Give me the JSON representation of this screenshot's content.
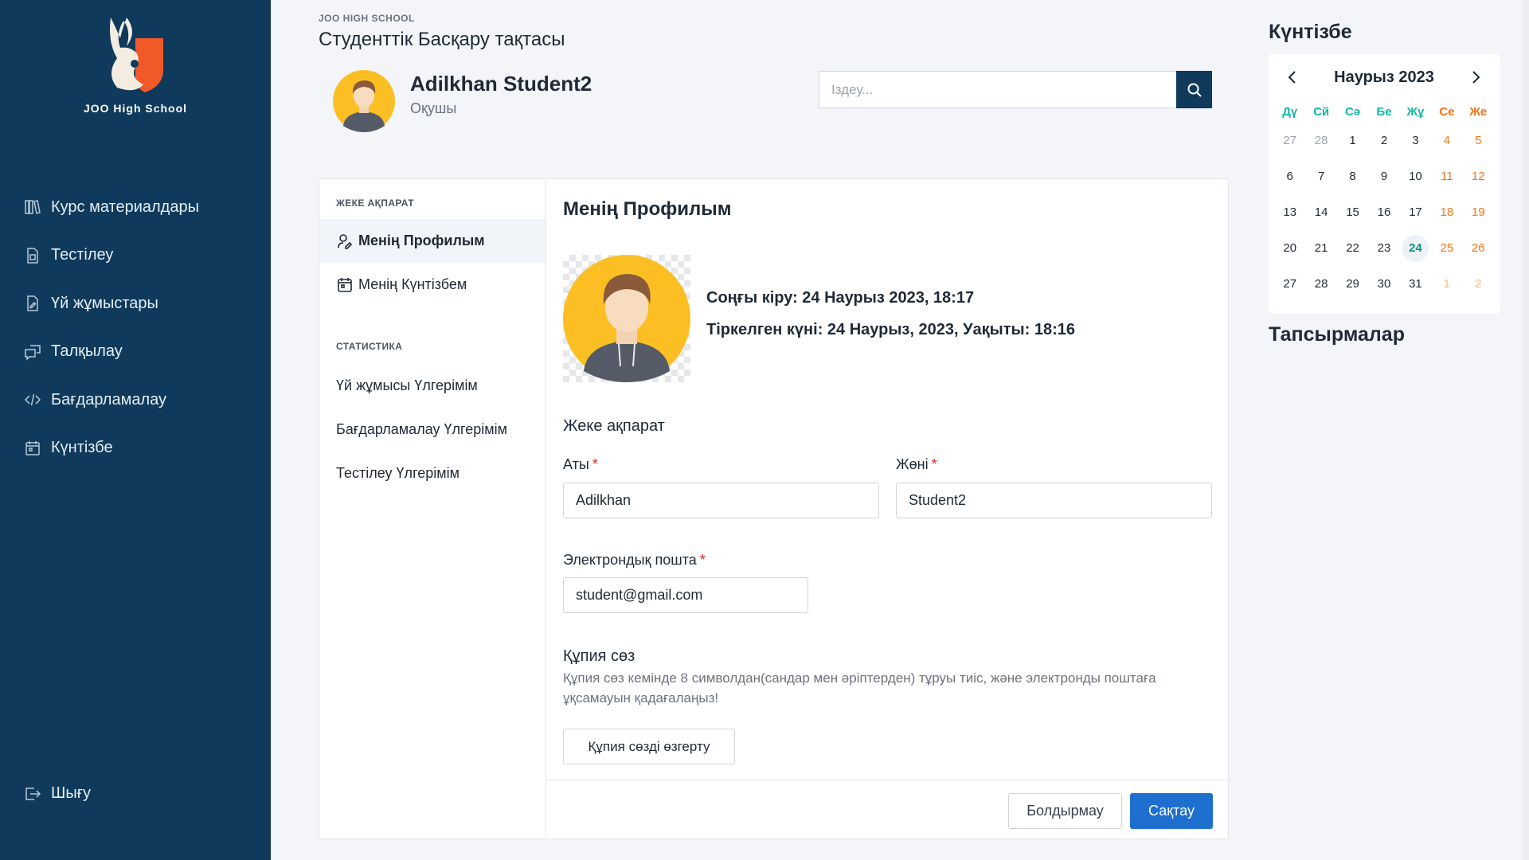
{
  "school": {
    "name": "JOO High School",
    "header_label": "JOO HIGH SCHOOL"
  },
  "dashboard_title": "Студенттік Басқару тақтасы",
  "user": {
    "name": "Adilkhan Student2",
    "role": "Оқушы"
  },
  "search": {
    "placeholder": "Іздеу..."
  },
  "sidebar": {
    "items": [
      {
        "label": "Курс материалдары",
        "icon": "books-icon"
      },
      {
        "label": "Тестілеу",
        "icon": "test-document-icon"
      },
      {
        "label": "Үй жұмыстары",
        "icon": "edit-document-icon"
      },
      {
        "label": "Талқылау",
        "icon": "chat-icon"
      },
      {
        "label": "Бағдарламалау",
        "icon": "code-icon"
      },
      {
        "label": "Күнтізбе",
        "icon": "calendar-icon"
      }
    ],
    "logout": "Шығу"
  },
  "subnav": {
    "personal_section": "ЖЕКЕ АҚПАРАТ",
    "profile": "Менің Профилым",
    "calendar": "Менің Күнтізбем",
    "stats_section": "СТАТИСТИКА",
    "homework_progress": "Үй жұмысы Үлгерімім",
    "programming_progress": "Бағдарламалау Үлгерімім",
    "testing_progress": "Тестілеу Үлгерімім"
  },
  "profile": {
    "title": "Менің Профилым",
    "last_login": "Соңғы кіру: 24 Наурыз 2023, 18:17",
    "registered": "Тіркелген күні: 24 Наурыз, 2023, Уақыты: 18:16",
    "personal_heading": "Жеке ақпарат",
    "first_name_label": "Аты",
    "first_name": "Adilkhan",
    "last_name_label": "Жөні",
    "last_name": "Student2",
    "email_label": "Электрондық пошта",
    "email": "student@gmail.com",
    "required_mark": "*",
    "password_heading": "Құпия сөз",
    "password_help": "Құпия сөз кемінде 8 символдан(сандар мен әріптерден) тұруы тиіс, және электронды поштаға ұқсамауын қадағалаңыз!",
    "change_password": "Құпия сөзді өзгерту",
    "cancel": "Болдырмау",
    "save": "Сақтау"
  },
  "calendar": {
    "heading": "Күнтізбе",
    "month": "Наурыз 2023",
    "weekdays": [
      "Дү",
      "Сй",
      "Сә",
      "Бе",
      "Жұ",
      "Се",
      "Же"
    ],
    "weeks": [
      [
        "27",
        "28",
        "1",
        "2",
        "3",
        "4",
        "5"
      ],
      [
        "6",
        "7",
        "8",
        "9",
        "10",
        "11",
        "12"
      ],
      [
        "13",
        "14",
        "15",
        "16",
        "17",
        "18",
        "19"
      ],
      [
        "20",
        "21",
        "22",
        "23",
        "24",
        "25",
        "26"
      ],
      [
        "27",
        "28",
        "29",
        "30",
        "31",
        "1",
        "2"
      ]
    ],
    "today": "24"
  },
  "tasks_heading": "Тапсырмалар",
  "colors": {
    "sidebar": "#0f3a5c",
    "accent": "#1f6fcf",
    "weekday": "#14b8a6",
    "weekend": "#f97316",
    "logo_orange": "#f05a28",
    "avatar_yellow": "#fbbf24"
  }
}
